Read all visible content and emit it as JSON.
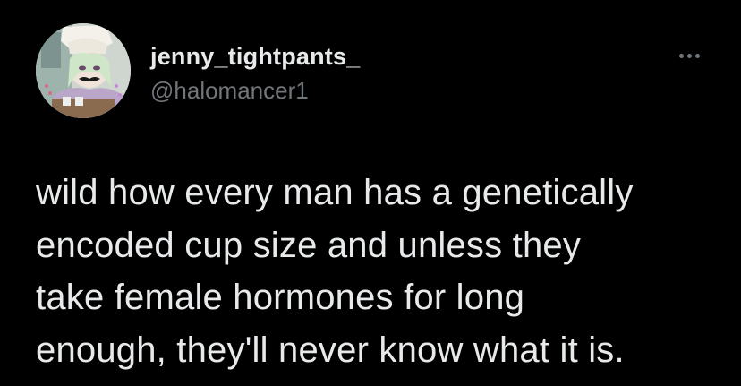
{
  "tweet": {
    "display_name": "jenny_tightpants_",
    "handle": "@halomancer1",
    "more_icon": "more-horizontal-icon",
    "text_lines": [
      "wild how every man has a genetically",
      "encoded cup size and unless they",
      "take female hormones for long",
      "enough, they'll never know what it is."
    ]
  },
  "colors": {
    "background": "#000000",
    "primary_text": "#e7e9ea",
    "secondary_text": "#71767b"
  }
}
